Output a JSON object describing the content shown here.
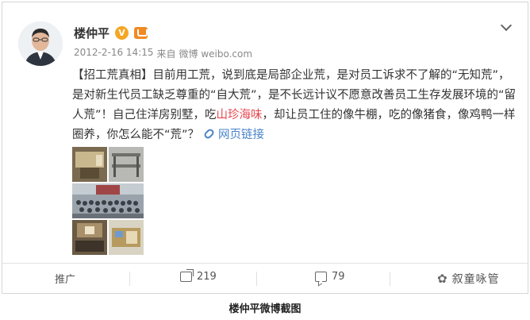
{
  "post": {
    "author": "楼仲平",
    "verified_badge": "V",
    "timestamp": "2012-2-16 14:15",
    "source_prefix": "来自",
    "source": "微博 weibo.com",
    "text": {
      "part1": "【招工荒真相】目前用工荒，说到底是局部企业荒，是对员工诉求不了解的“无知荒”，是对新生代员工缺乏尊重的“自大荒”，是不长远计议不愿意改善员工生存发展环境的“留人荒”！自己住洋房别墅，吃",
      "highlight": "山珍海味",
      "part2": "，却让员工住的像牛棚，吃的像猪食，像鸡鸭一样圈养，你怎么能不“荒”？",
      "link_label": "网页链接"
    },
    "icons": {
      "menu": "chevron-down-icon",
      "link": "link-icon",
      "repost": "share-icon",
      "comment": "comment-icon",
      "watermark": "wechat-icon"
    }
  },
  "actions": {
    "promote": "推广",
    "reposts": "219",
    "comments": "79",
    "watermark": "叙童咏管"
  },
  "caption": "楼仲平微博截图",
  "colors": {
    "link": "#4a84c9",
    "highlight": "#e8444f",
    "badge": "#f5a623"
  }
}
